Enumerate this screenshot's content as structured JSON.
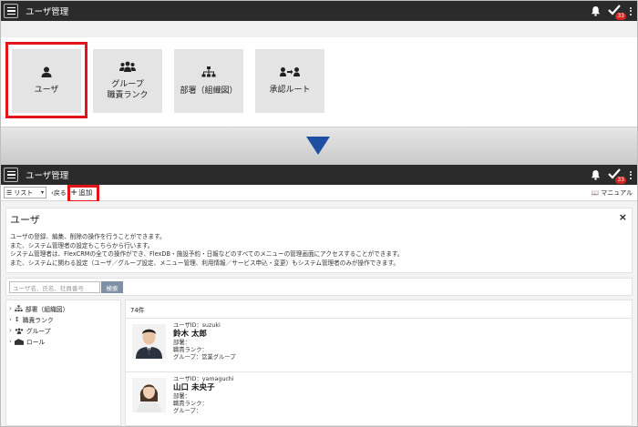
{
  "app": {
    "title": "ユーザ管理",
    "badge_count": "33"
  },
  "tiles": [
    {
      "label_line1": "ユーザ",
      "label_line2": ""
    },
    {
      "label_line1": "グループ",
      "label_line2": "職責ランク"
    },
    {
      "label_line1": "部署（組織図）",
      "label_line2": ""
    },
    {
      "label_line1": "承認ルート",
      "label_line2": ""
    }
  ],
  "toolbar": {
    "list_label": "リスト",
    "back_label": "戻る",
    "add_label": "追加",
    "manual_label": "マニュアル"
  },
  "description": {
    "heading": "ユーザ",
    "close": "×",
    "lines": [
      "ユーザの登録、編集、削除の操作を行うことができます。",
      "また、システム管理者の設定もこちらから行います。",
      "システム管理者は、FlexCRMの全ての操作ができ、FlexDB・施設予約・日報などのすべてのメニューの管理画面にアクセスすることができます。",
      "また、システムに関わる設定（ユーザ／グループ設定、メニュー管理、利用情報／サービス申込・変更）もシステム管理者のみが操作できます。"
    ]
  },
  "search": {
    "placeholder": "ユーザ名、氏名、社員番号",
    "button_label": "検索"
  },
  "tree": [
    {
      "label": "部署（組織図）",
      "icon": "org-chart-icon"
    },
    {
      "label": "職責ランク",
      "icon": "rank-icon"
    },
    {
      "label": "グループ",
      "icon": "group-icon"
    },
    {
      "label": "ロール",
      "icon": "role-icon"
    }
  ],
  "results": {
    "count": "74件",
    "users": [
      {
        "id_label": "ユーザID：suzuki",
        "name": "鈴木 太郎",
        "dept": "部署：",
        "rank": "職責ランク：",
        "group": "グループ：営業グループ"
      },
      {
        "id_label": "ユーザID：yamaguchi",
        "name": "山口 未央子",
        "dept": "部署：",
        "rank": "職責ランク：",
        "group": "グループ："
      }
    ]
  },
  "colors": {
    "header_bg": "#2b2b2b",
    "highlight": "#e3151a",
    "arrow": "#1f4fa3",
    "badge": "#d62222",
    "search_button": "#7f8fa6"
  }
}
